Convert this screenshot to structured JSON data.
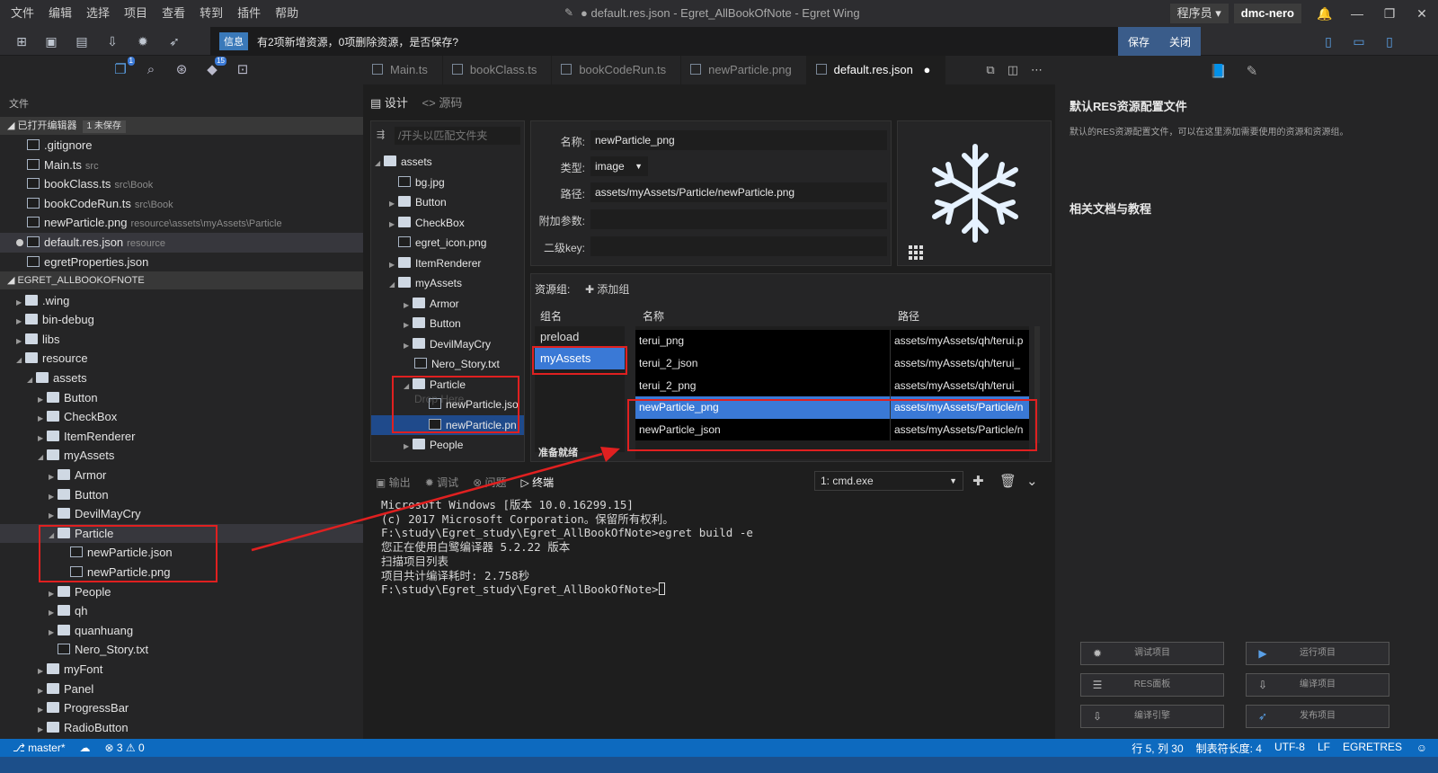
{
  "menu": [
    "文件",
    "编辑",
    "选择",
    "项目",
    "查看",
    "转到",
    "插件",
    "帮助"
  ],
  "window_title": "● default.res.json - Egret_AllBookOfNote - Egret Wing",
  "role_select": "程序员",
  "user": "dmc-nero",
  "notification": {
    "badge": "信息",
    "text": "有2项新增资源，0项删除资源，是否保存?",
    "save": "保存",
    "close": "关闭"
  },
  "activity_badges": {
    "explorer": "1",
    "git": "15"
  },
  "explorer": {
    "heading": "文件",
    "open_editors": {
      "label": "已打开编辑器",
      "badge": "1 未保存"
    },
    "open_files": [
      {
        "name": ".gitignore",
        "path": ""
      },
      {
        "name": "Main.ts",
        "path": "src"
      },
      {
        "name": "bookClass.ts",
        "path": "src\\Book"
      },
      {
        "name": "bookCodeRun.ts",
        "path": "src\\Book"
      },
      {
        "name": "newParticle.png",
        "path": "resource\\assets\\myAssets\\Particle"
      },
      {
        "name": "default.res.json",
        "path": "resource"
      },
      {
        "name": "egretProperties.json",
        "path": ""
      }
    ],
    "project": "EGRET_ALLBOOKOFNOTE",
    "tree": [
      ".wing",
      "bin-debug",
      "libs",
      "resource",
      "assets",
      "Button",
      "CheckBox",
      "ItemRenderer",
      "myAssets",
      "Armor",
      "Button",
      "DevilMayCry",
      "Particle",
      "newParticle.json",
      "newParticle.png",
      "People",
      "qh",
      "quanhuang",
      "Nero_Story.txt",
      "myFont",
      "Panel",
      "ProgressBar",
      "RadioButton"
    ]
  },
  "tabs": [
    "Main.ts",
    "bookClass.ts",
    "bookCodeRun.ts",
    "newParticle.png",
    "default.res.json"
  ],
  "mode": {
    "design": "设计",
    "source": "源码"
  },
  "folder_tree": {
    "filter_placeholder": "/开头以匹配文件夹",
    "items": [
      "assets",
      "bg.jpg",
      "Button",
      "CheckBox",
      "egret_icon.png",
      "ItemRenderer",
      "myAssets",
      "Armor",
      "Button",
      "DevilMayCry",
      "Nero_Story.txt",
      "Particle",
      "newParticle.jso",
      "newParticle.pn",
      "People"
    ],
    "drag_ghost": "Drop Here"
  },
  "props": {
    "name_label": "名称:",
    "name": "newParticle_png",
    "type_label": "类型:",
    "type": "image",
    "path_label": "路径:",
    "path": "assets/myAssets/Particle/newParticle.png",
    "extra_label": "附加参数:",
    "extra": "",
    "subkey_label": "二级key:",
    "subkey": ""
  },
  "groups": {
    "title": "资源组:",
    "add": "添加组",
    "col_group": "组名",
    "col_name": "名称",
    "col_path": "路径",
    "names": [
      "preload",
      "myAssets"
    ],
    "status": "准备就绪",
    "rows": [
      {
        "name": "terui_png",
        "path": "assets/myAssets/qh/terui.p"
      },
      {
        "name": "terui_2_json",
        "path": "assets/myAssets/qh/terui_"
      },
      {
        "name": "terui_2_png",
        "path": "assets/myAssets/qh/terui_"
      },
      {
        "name": "newParticle_png",
        "path": "assets/myAssets/Particle/n"
      },
      {
        "name": "newParticle_json",
        "path": "assets/myAssets/Particle/n"
      }
    ]
  },
  "terminal": {
    "tabs": [
      "输出",
      "调试",
      "问题",
      "终端"
    ],
    "select": "1: cmd.exe",
    "lines": [
      "Microsoft Windows [版本 10.0.16299.15]",
      "(c) 2017 Microsoft Corporation。保留所有权利。",
      "",
      "F:\\study\\Egret_study\\Egret_AllBookOfNote>egret build -e",
      "您正在使用白鹭编译器 5.2.22 版本",
      "扫描项目列表",
      "项目共计编译耗时: 2.758秒",
      "",
      "F:\\study\\Egret_study\\Egret_AllBookOfNote>"
    ]
  },
  "right_panel": {
    "title": "默认RES资源配置文件",
    "desc": "默认的RES资源配置文件，可以在这里添加需要使用的资源和资源组。",
    "sub": "相关文档与教程",
    "buttons": [
      "调试项目",
      "运行项目",
      "RES面板",
      "编译项目",
      "编译引擎",
      "发布项目"
    ]
  },
  "status": {
    "branch": "master*",
    "errors": "3",
    "warnings": "0",
    "position": "行 5, 列 30",
    "tab_size": "制表符长度: 4",
    "encoding": "UTF-8",
    "eol": "LF",
    "lang": "EGRETRES"
  },
  "colors": {
    "accent": "#3a79d6",
    "status_bar": "#0d6abf",
    "annotation": "#e02020"
  }
}
